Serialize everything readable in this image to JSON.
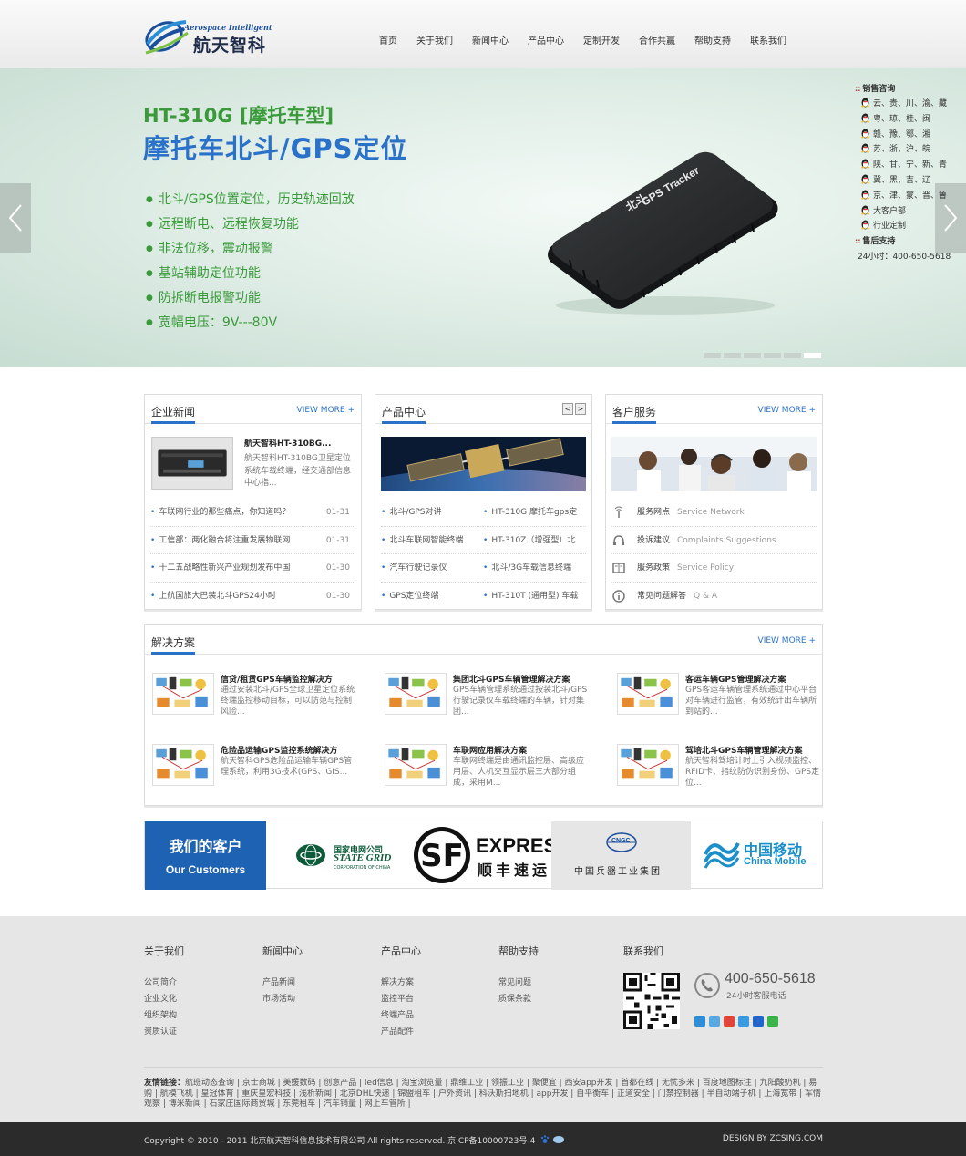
{
  "header": {
    "logo_en": "Aerospace Intelligent",
    "logo_cn": "航天智科",
    "nav": [
      "首页",
      "关于我们",
      "新闻中心",
      "产品中心",
      "定制开发",
      "合作共赢",
      "帮助支持",
      "联系我们"
    ]
  },
  "banner": {
    "model": "HT-310G [摩托车型]",
    "title": "摩托车北斗/GPS定位",
    "features": [
      "北斗/GPS位置定位，历史轨迹回放",
      "远程断电、远程恢复功能",
      "非法位移，震动报警",
      "基站辅助定位功能",
      "防拆断电报警功能",
      "宽幅电压：9V---80V"
    ],
    "device_label_1": "北斗",
    "device_label_2": "GPS Tracker",
    "slide_count": 6,
    "active_slide": 6
  },
  "float_panel": {
    "sales_head": "销售咨询",
    "sales_items": [
      "云、贵、川、渝、藏",
      "粤、琼、桂、闽",
      "赣、豫、鄂、湘",
      "苏、浙、沪、皖",
      "陕、甘、宁、新、青",
      "冀、黑、吉、辽",
      "京、津、蒙、晋、鲁",
      "大客户部",
      "行业定制"
    ],
    "support_head": "售后支持",
    "support_phone": "24小时：400-650-5618"
  },
  "news": {
    "title": "企业新闻",
    "more": "VIEW MORE +",
    "feature_title": "航天智科HT-310BG...",
    "feature_desc": "航天智科HT-310BG卫星定位系统车载终端，经交通部信息中心指...",
    "items": [
      {
        "title": "车联网行业的那些痛点，你知道吗？",
        "date": "01-31"
      },
      {
        "title": "工信部：两化融合将注重发展物联网",
        "date": "01-31"
      },
      {
        "title": "十二五战略性新兴产业规划发布中国",
        "date": "01-30"
      },
      {
        "title": "上航国旅大巴装北斗GPS24小时",
        "date": "01-30"
      }
    ]
  },
  "products": {
    "title": "产品中心",
    "prev": "<",
    "next": ">",
    "items": [
      "北斗/GPS对讲",
      "HT-310G 摩托车gps定",
      "北斗车联网智能终端",
      "HT-310Z（增强型）北",
      "汽车行驶记录仪",
      "北斗/3G车载信息终端",
      "GPS定位终端",
      "HT-310T (通用型) 车载"
    ]
  },
  "service": {
    "title": "客户服务",
    "more": "VIEW MORE +",
    "items": [
      {
        "cn": "服务网点",
        "en": "Service Network",
        "icon": "signal-icon"
      },
      {
        "cn": "投诉建议",
        "en": "Complaints Suggestions",
        "icon": "headset-icon"
      },
      {
        "cn": "服务政策",
        "en": "Service Policy",
        "icon": "book-icon"
      },
      {
        "cn": "常见问题解答",
        "en": "Q & A",
        "icon": "info-icon"
      }
    ]
  },
  "solutions": {
    "title": "解决方案",
    "more": "VIEW MORE +",
    "items": [
      {
        "title": "信贷/租赁GPS车辆监控解决方",
        "desc": "通过安装北斗/GPS全球卫星定位系统终端监控移动目标，可以防范与控制风险..."
      },
      {
        "title": "集团北斗GPS车辆管理解决方案",
        "desc": "GPS车辆管理系统通过按装北斗/GPS行驶记录仪车载终端的车辆，针对集团..."
      },
      {
        "title": "客运车辆GPS管理解决方案",
        "desc": "GPS客运车辆管理系统通过中心平台对车辆进行监管，有效统计出车辆所到站的..."
      },
      {
        "title": "危险品运输GPS监控系统解决方",
        "desc": "航天智科GPS危险品运输车辆GPS管理系统，利用3G技术(GPS、GIS..."
      },
      {
        "title": "车联网应用解决方案",
        "desc": "车联网终端是由通讯监控层、高级应用层、人机交互显示层三大部分组成，采用M..."
      },
      {
        "title": "驾培北斗GPS车辆管理解决方案",
        "desc": "航天智科驾培计时上引入视频监控、RFID卡、指纹防伪识别身份、GPS定位..."
      }
    ]
  },
  "customers": {
    "title_cn": "我们的客户",
    "title_en": "Our Customers",
    "logos": {
      "stategrid_cn": "国家电网公司",
      "stategrid_en": "STATE GRID",
      "stategrid_sub": "CORPORATION OF CHINA",
      "sf_en": "EXPRESS",
      "sf_cn": "顺丰速运",
      "cngc_en": "CNGC",
      "cngc_cn": "中国兵器工业集团",
      "cm_cn": "中国移动",
      "cm_en": "China Mobile"
    }
  },
  "footer": {
    "cols": [
      {
        "title": "关于我们",
        "links": [
          "公司简介",
          "企业文化",
          "组织架构",
          "资质认证"
        ]
      },
      {
        "title": "新闻中心",
        "links": [
          "产品新闻",
          "市场活动"
        ]
      },
      {
        "title": "产品中心",
        "links": [
          "解决方案",
          "监控平台",
          "终端产品",
          "产品配件"
        ]
      },
      {
        "title": "帮助支持",
        "links": [
          "常见问题",
          "质保条款"
        ]
      }
    ],
    "contact_title": "联系我们",
    "phone": "400-650-5618",
    "phone_sub": "24小时客服电话",
    "links_label": "友情链接：",
    "links": "航班动态查询 | 京士商城 | 美媛数码 | 创意产品 | led信息 | 淘宝浏览量 | 鼎维工业 | 领振工业 | 聚便宜 | 西安app开发 | 首都在线 | 无忧多米 | 百度地图标注 | 九阳酸奶机 | 易购 | 航模飞机 | 皇冠体育 | 重庆皇宏科技 | 浅析新闻 | 北京DHL快递 | 锦盟租车 | 户外资讯 | 科沃斯扫地机 | app开发 | 自平衡车 | 正道安全 | 门禁控制器 | 半自动端子机 | 上海宽带 | 军情观察 | 博米新闻 | 石家庄国际商贸城 | 东莞租车 | 汽车销量 | 网上车管所 |",
    "copyright": "Copyright © 2010 - 2011 北京航天智科信息技术有限公司 All rights reserved. 京ICP备10000723号-4",
    "design": "DESIGN BY ZCSING.COM"
  }
}
